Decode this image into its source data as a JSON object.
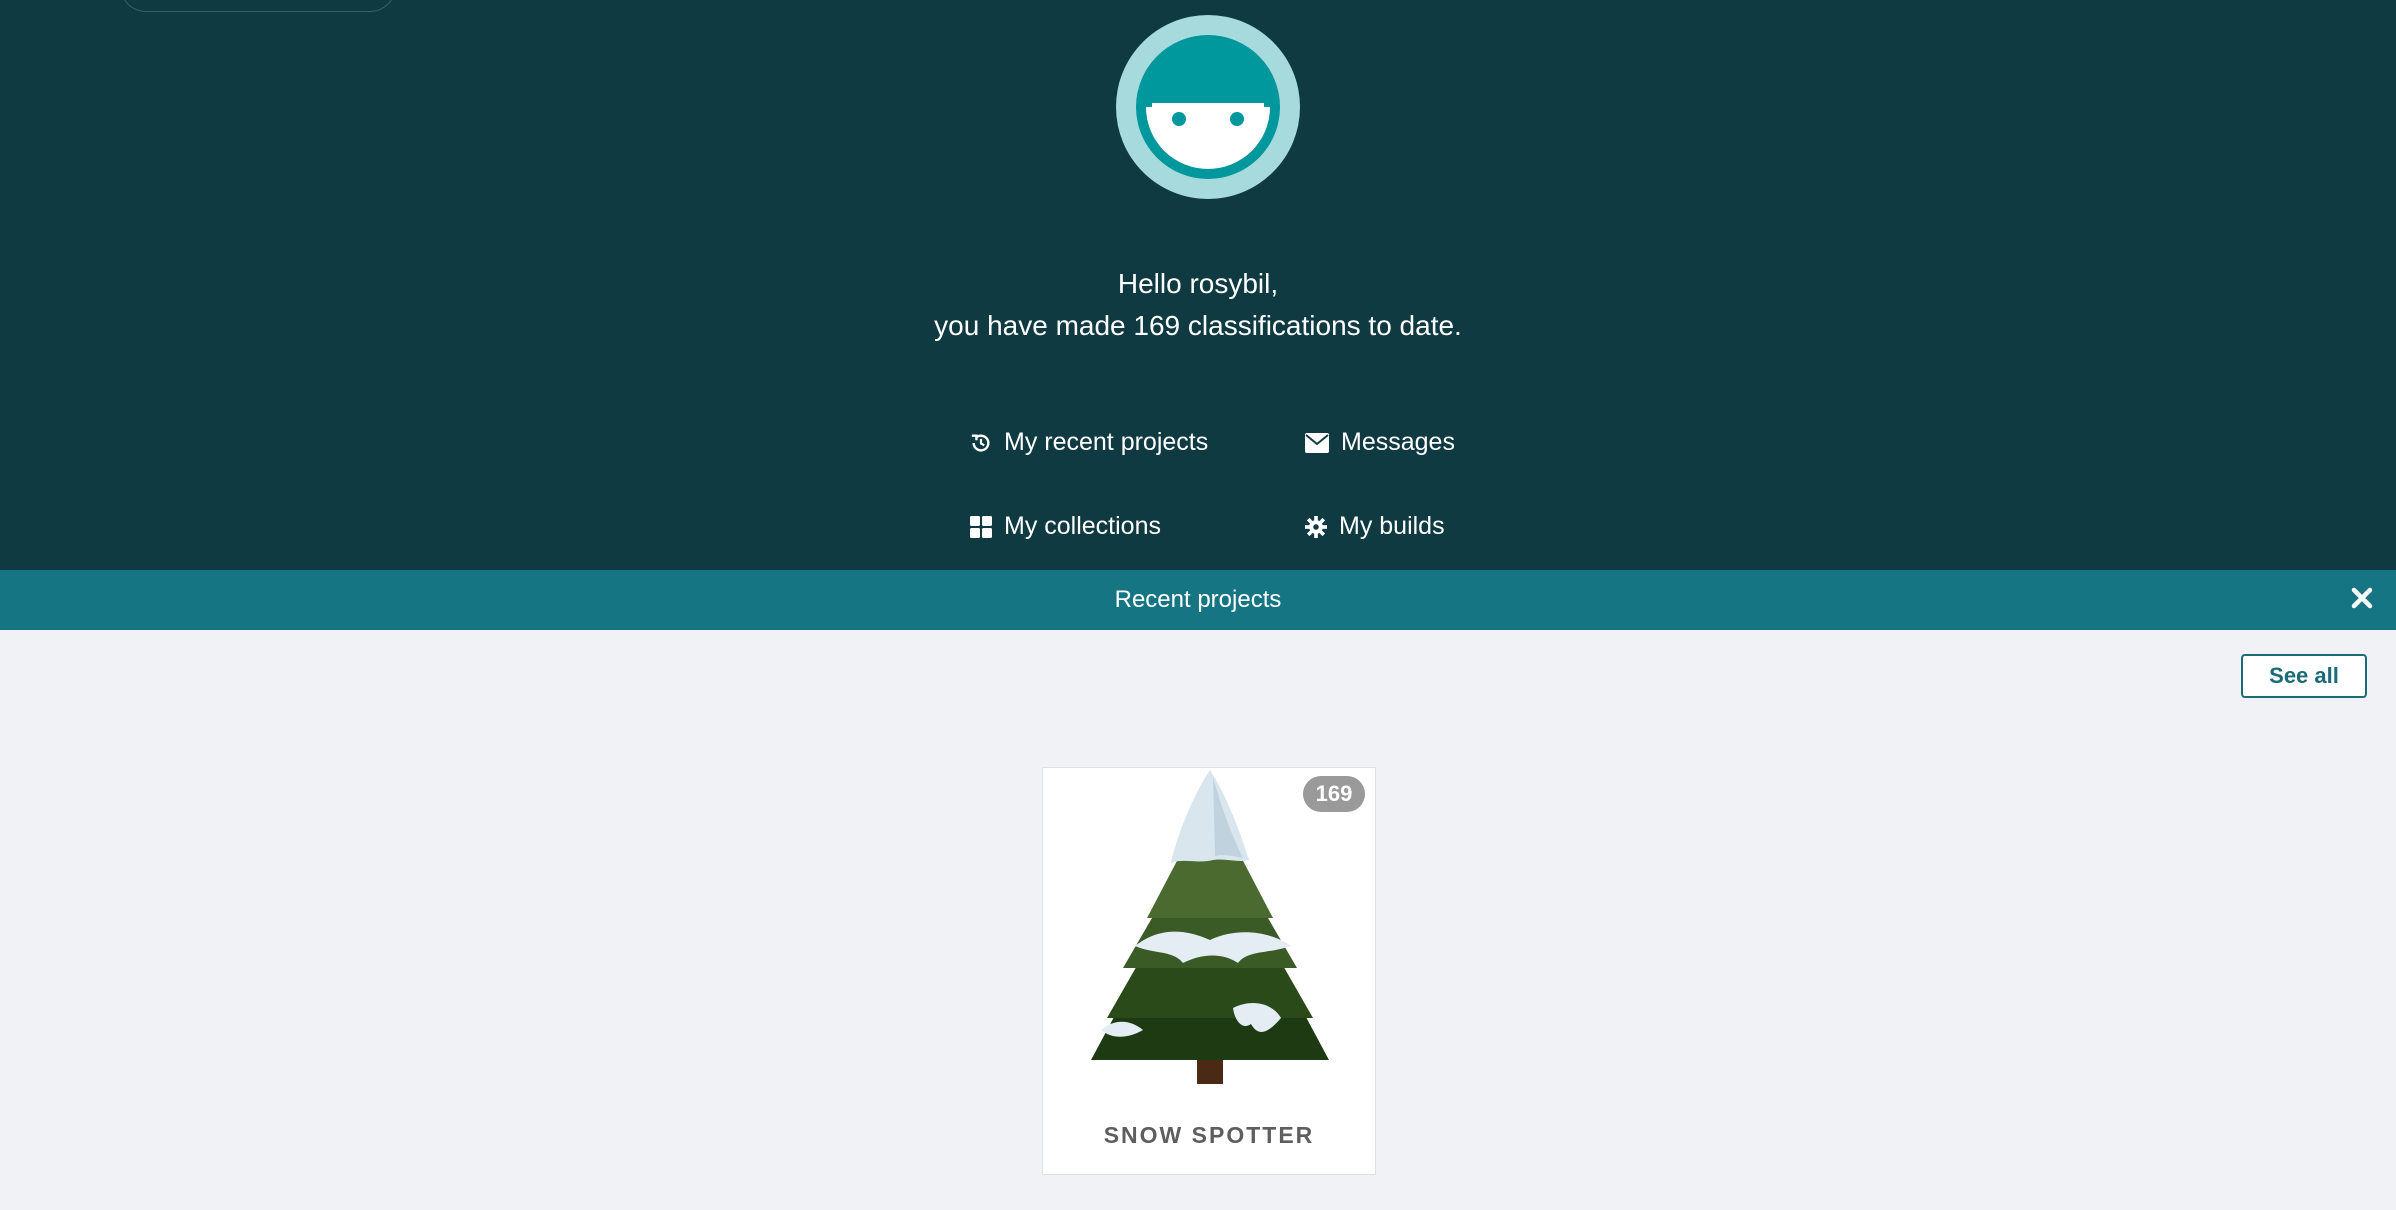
{
  "hero": {
    "greeting_line1": "Hello rosybil,",
    "greeting_line2": "you have made 169 classifications to date.",
    "links": {
      "recent_projects": "My recent projects",
      "messages": "Messages",
      "collections": "My collections",
      "builds": "My builds"
    }
  },
  "recent": {
    "title": "Recent projects",
    "see_all": "See all",
    "projects": [
      {
        "name": "SNOW SPOTTER",
        "count": "169"
      }
    ]
  },
  "colors": {
    "hero_bg": "#0f3a42",
    "bar_bg": "#167583",
    "accent": "#00979d"
  }
}
